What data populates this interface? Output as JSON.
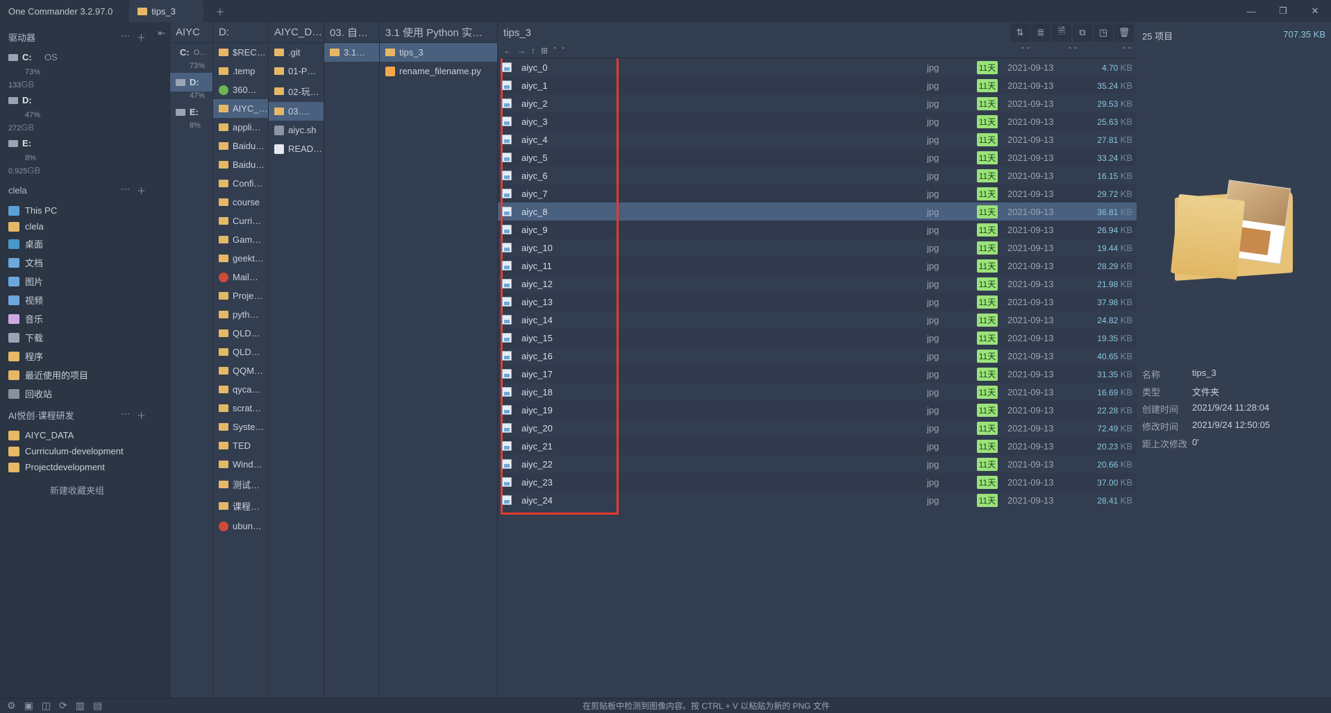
{
  "app": {
    "title": "One Commander 3.2.97.0",
    "active_tab": "tips_3"
  },
  "window_controls": [
    "minimize",
    "maximize",
    "close"
  ],
  "sidebar": {
    "drives_header": "驱动器",
    "drives": [
      {
        "label": "C:",
        "tag": "OS",
        "pct": "73%",
        "size": "133",
        "unit": "GB"
      },
      {
        "label": "D:",
        "tag": "",
        "pct": "47%",
        "size": "272",
        "unit": "GB"
      },
      {
        "label": "E:",
        "tag": "",
        "pct": "8%",
        "size": "0.925",
        "unit": "GB"
      }
    ],
    "group1": {
      "header": "clela",
      "items": [
        {
          "icon": "ic-pc",
          "label": "This PC"
        },
        {
          "icon": "ic-folder",
          "label": "clela"
        },
        {
          "icon": "ic-desk",
          "label": "桌面"
        },
        {
          "icon": "ic-blue",
          "label": "文档"
        },
        {
          "icon": "ic-blue",
          "label": "图片"
        },
        {
          "icon": "ic-blue",
          "label": "视频"
        },
        {
          "icon": "ic-note",
          "label": "音乐"
        },
        {
          "icon": "ic-down",
          "label": "下载"
        },
        {
          "icon": "ic-prog",
          "label": "程序"
        },
        {
          "icon": "ic-rec",
          "label": "最近使用的项目"
        },
        {
          "icon": "ic-bin",
          "label": "回收站"
        }
      ]
    },
    "group2": {
      "header": "AI悦创·课程研发",
      "items": [
        {
          "label": "AIYC_DATA"
        },
        {
          "label": "Curriculum-development"
        },
        {
          "label": "Projectdevelopment"
        }
      ]
    },
    "new_fav": "新建收藏夹组"
  },
  "columns": {
    "c0": {
      "title": "AIYC",
      "drives": [
        {
          "label": "C:",
          "tag": "O…",
          "pct": "73%"
        },
        {
          "label": "D:",
          "pct": "47%",
          "selected": true
        },
        {
          "label": "E:",
          "pct": "8%"
        }
      ]
    },
    "c1": {
      "title": "D:",
      "items": [
        {
          "type": "folder",
          "label": "$REC…"
        },
        {
          "type": "folder",
          "label": ".temp"
        },
        {
          "type": "green",
          "label": "360…"
        },
        {
          "type": "folder",
          "label": "AIYC_…",
          "selected": true
        },
        {
          "type": "folder",
          "label": "appli…"
        },
        {
          "type": "folder",
          "label": "Baidu…"
        },
        {
          "type": "folder",
          "label": "Baidu…"
        },
        {
          "type": "folder",
          "label": "Confi…"
        },
        {
          "type": "folder",
          "label": "course"
        },
        {
          "type": "folder",
          "label": "Curri…"
        },
        {
          "type": "folder",
          "label": "Gam…"
        },
        {
          "type": "folder",
          "label": "geekt…"
        },
        {
          "type": "red",
          "label": "Mail…"
        },
        {
          "type": "folder",
          "label": "Proje…"
        },
        {
          "type": "folder",
          "label": "pyth…"
        },
        {
          "type": "folder",
          "label": "QLD…"
        },
        {
          "type": "folder",
          "label": "QLD…"
        },
        {
          "type": "folder",
          "label": "QQM…"
        },
        {
          "type": "folder",
          "label": "qyca…"
        },
        {
          "type": "folder",
          "label": "scrat…"
        },
        {
          "type": "folder",
          "label": "Syste…"
        },
        {
          "type": "folder",
          "label": "TED"
        },
        {
          "type": "folder",
          "label": "Wind…"
        },
        {
          "type": "folder",
          "label": "测试…"
        },
        {
          "type": "folder",
          "label": "课程…"
        },
        {
          "type": "red",
          "label": "ubun…"
        }
      ]
    },
    "c2": {
      "title": "AIYC_D…",
      "items": [
        {
          "type": "folder",
          "label": ".git"
        },
        {
          "type": "folder",
          "label": "01-P…"
        },
        {
          "type": "folder",
          "label": "02-玩…"
        },
        {
          "type": "folder",
          "label": "03.…",
          "selected": true
        },
        {
          "type": "sh",
          "label": "aiyc.sh"
        },
        {
          "type": "md",
          "label": "READ…"
        }
      ]
    },
    "c3": {
      "title": "03. 自…",
      "items": [
        {
          "type": "folder",
          "label": "3.1…",
          "selected": true
        }
      ]
    },
    "c4": {
      "title": "3.1 使用 Python 实…",
      "items": [
        {
          "type": "folder",
          "label": "tips_3",
          "selected": true
        },
        {
          "type": "py",
          "label": "rename_filename.py"
        }
      ]
    }
  },
  "main_col": {
    "title": "tips_3",
    "toolbar": [
      "sort",
      "list",
      "doc",
      "copy",
      "open",
      "delete"
    ],
    "files": [
      {
        "name": "aiyc_0",
        "ext": "jpg",
        "age": "11天",
        "date": "2021-09-13",
        "size": "4.70",
        "unit": "KB"
      },
      {
        "name": "aiyc_1",
        "ext": "jpg",
        "age": "11天",
        "date": "2021-09-13",
        "size": "35.24",
        "unit": "KB"
      },
      {
        "name": "aiyc_2",
        "ext": "jpg",
        "age": "11天",
        "date": "2021-09-13",
        "size": "29.53",
        "unit": "KB"
      },
      {
        "name": "aiyc_3",
        "ext": "jpg",
        "age": "11天",
        "date": "2021-09-13",
        "size": "25.63",
        "unit": "KB"
      },
      {
        "name": "aiyc_4",
        "ext": "jpg",
        "age": "11天",
        "date": "2021-09-13",
        "size": "27.81",
        "unit": "KB"
      },
      {
        "name": "aiyc_5",
        "ext": "jpg",
        "age": "11天",
        "date": "2021-09-13",
        "size": "33.24",
        "unit": "KB"
      },
      {
        "name": "aiyc_6",
        "ext": "jpg",
        "age": "11天",
        "date": "2021-09-13",
        "size": "16.15",
        "unit": "KB"
      },
      {
        "name": "aiyc_7",
        "ext": "jpg",
        "age": "11天",
        "date": "2021-09-13",
        "size": "29.72",
        "unit": "KB"
      },
      {
        "name": "aiyc_8",
        "ext": "jpg",
        "age": "11天",
        "date": "2021-09-13",
        "size": "36.81",
        "unit": "KB",
        "selected": true
      },
      {
        "name": "aiyc_9",
        "ext": "jpg",
        "age": "11天",
        "date": "2021-09-13",
        "size": "26.94",
        "unit": "KB"
      },
      {
        "name": "aiyc_10",
        "ext": "jpg",
        "age": "11天",
        "date": "2021-09-13",
        "size": "19.44",
        "unit": "KB"
      },
      {
        "name": "aiyc_11",
        "ext": "jpg",
        "age": "11天",
        "date": "2021-09-13",
        "size": "28.29",
        "unit": "KB"
      },
      {
        "name": "aiyc_12",
        "ext": "jpg",
        "age": "11天",
        "date": "2021-09-13",
        "size": "21.98",
        "unit": "KB"
      },
      {
        "name": "aiyc_13",
        "ext": "jpg",
        "age": "11天",
        "date": "2021-09-13",
        "size": "37.98",
        "unit": "KB"
      },
      {
        "name": "aiyc_14",
        "ext": "jpg",
        "age": "11天",
        "date": "2021-09-13",
        "size": "24.82",
        "unit": "KB"
      },
      {
        "name": "aiyc_15",
        "ext": "jpg",
        "age": "11天",
        "date": "2021-09-13",
        "size": "19.35",
        "unit": "KB"
      },
      {
        "name": "aiyc_16",
        "ext": "jpg",
        "age": "11天",
        "date": "2021-09-13",
        "size": "40.65",
        "unit": "KB"
      },
      {
        "name": "aiyc_17",
        "ext": "jpg",
        "age": "11天",
        "date": "2021-09-13",
        "size": "31.35",
        "unit": "KB"
      },
      {
        "name": "aiyc_18",
        "ext": "jpg",
        "age": "11天",
        "date": "2021-09-13",
        "size": "16.69",
        "unit": "KB"
      },
      {
        "name": "aiyc_19",
        "ext": "jpg",
        "age": "11天",
        "date": "2021-09-13",
        "size": "22.28",
        "unit": "KB"
      },
      {
        "name": "aiyc_20",
        "ext": "jpg",
        "age": "11天",
        "date": "2021-09-13",
        "size": "72.49",
        "unit": "KB"
      },
      {
        "name": "aiyc_21",
        "ext": "jpg",
        "age": "11天",
        "date": "2021-09-13",
        "size": "20.23",
        "unit": "KB"
      },
      {
        "name": "aiyc_22",
        "ext": "jpg",
        "age": "11天",
        "date": "2021-09-13",
        "size": "20.66",
        "unit": "KB"
      },
      {
        "name": "aiyc_23",
        "ext": "jpg",
        "age": "11天",
        "date": "2021-09-13",
        "size": "37.00",
        "unit": "KB"
      },
      {
        "name": "aiyc_24",
        "ext": "jpg",
        "age": "11天",
        "date": "2021-09-13",
        "size": "28.41",
        "unit": "KB"
      }
    ]
  },
  "details": {
    "count": "25 项目",
    "total_size": "707.35 KB",
    "meta": [
      {
        "k": "名称",
        "v": "tips_3"
      },
      {
        "k": "类型",
        "v": "文件夹"
      },
      {
        "k": "创建时间",
        "v": "2021/9/24 11:28:04"
      },
      {
        "k": "修改时间",
        "v": "2021/9/24 12:50:05"
      },
      {
        "k": "距上次修改",
        "v": "0'"
      }
    ]
  },
  "bottombar": {
    "message": "在剪贴板中检测到图像内容。按 CTRL + V 以粘贴为新的 PNG 文件"
  }
}
